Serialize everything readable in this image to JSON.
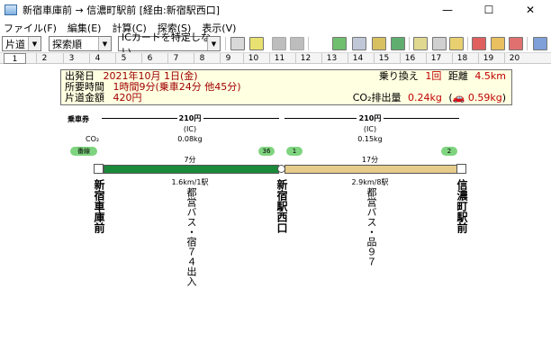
{
  "window": {
    "title": "新宿車庫前 → 信濃町駅前 [経由:新宿駅西口]",
    "minimize": "—",
    "maximize": "☐",
    "close": "✕"
  },
  "menu": [
    "ファイル(F)",
    "編集(E)",
    "計算(C)",
    "探索(S)",
    "表示(V)"
  ],
  "toolbar": {
    "trip_type": "片道",
    "sort_order": "探索順",
    "ic_card": "ICカードを特定しない"
  },
  "ruler": [
    "1",
    "2",
    "3",
    "4",
    "5",
    "6",
    "7",
    "8",
    "9",
    "10",
    "11",
    "12",
    "13",
    "14",
    "15",
    "16",
    "17",
    "18",
    "19",
    "20"
  ],
  "summary": {
    "date_label": "出発日",
    "date_value": "2021年10月 1日(金)",
    "time_label": "所要時間",
    "time_value": "1時間9分(乗車24分 他45分)",
    "fare_label": "片道金額",
    "fare_value": "420円",
    "transfer_label": "乗り換え",
    "transfer_value": "1回",
    "distance_label": "距離",
    "distance_value": "4.5km",
    "co2_label": "CO₂排出量",
    "co2_value": "0.24kg",
    "co2_car_value": "0.59kg",
    "paren_open": "(",
    "paren_close": ")"
  },
  "route": {
    "ticket_label": "乗車券",
    "co2_label": "CO₂",
    "platform_label": "番線",
    "segments": [
      {
        "fare": "210円",
        "fare_type": "(IC)",
        "co2": "0.08kg",
        "duration": "7分",
        "distance": "1.6km/1駅",
        "line": "都営バス・宿７４出入",
        "color": "#1a8a3a"
      },
      {
        "fare": "210円",
        "fare_type": "(IC)",
        "co2": "0.15kg",
        "duration": "17分",
        "distance": "2.9km/8駅",
        "line": "都営バス・品９７",
        "color": "#e6cc8a"
      }
    ],
    "badges": {
      "arrive_1": "36",
      "depart_2": "1",
      "arrive_2": "2"
    },
    "stations": [
      "新宿車庫前",
      "新宿駅西口",
      "信濃町駅前"
    ]
  }
}
